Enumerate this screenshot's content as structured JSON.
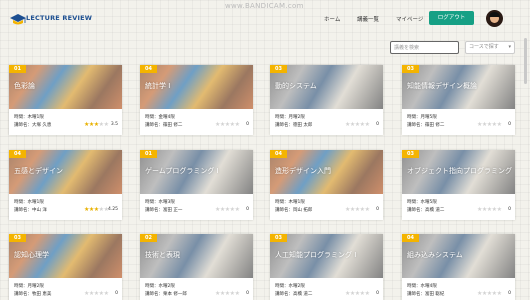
{
  "watermark": "www.BANDICAM.com",
  "logo": {
    "text": "LECTURE REVIEW"
  },
  "nav": {
    "home": "ホーム",
    "lectures": "講義一覧",
    "mypage": "マイページ",
    "logout": "ログアウト"
  },
  "search": {
    "placeholder": "講義を検索"
  },
  "filter": {
    "label": "コースで探す"
  },
  "labels": {
    "time": "時間：",
    "teacher": "講師名："
  },
  "colors": {
    "accent": "#16a085",
    "code_badge": "#f4b400",
    "star": "#e8b100"
  },
  "courses": [
    {
      "code": "01",
      "title": "色彩論",
      "time": "木曜1限",
      "teacher": "大塚 久恵",
      "stars": 3,
      "rating": "3.5",
      "image": "art"
    },
    {
      "code": "04",
      "title": "統計学 I",
      "time": "金曜4限",
      "teacher": "篠田 修二",
      "stars": 0,
      "rating": "0",
      "image": "art"
    },
    {
      "code": "03",
      "title": "動的システム",
      "time": "月曜2限",
      "teacher": "徳田 太郎",
      "stars": 0,
      "rating": "0",
      "image": "desk"
    },
    {
      "code": "03",
      "title": "知能情報デザイン概論",
      "time": "月曜5限",
      "teacher": "篠田 修二",
      "stars": 0,
      "rating": "0",
      "image": "desk"
    },
    {
      "code": "04",
      "title": "五感とデザイン",
      "time": "水曜1限",
      "teacher": "中山 洋",
      "stars": 3,
      "rating": "4.25",
      "image": "art"
    },
    {
      "code": "01",
      "title": "ゲームプログラミング I",
      "time": "水曜3限",
      "teacher": "富田 正一",
      "stars": 0,
      "rating": "0",
      "image": "desk"
    },
    {
      "code": "04",
      "title": "造形デザイン入門",
      "time": "木曜1限",
      "teacher": "岡山 拓郎",
      "stars": 0,
      "rating": "0",
      "image": "art"
    },
    {
      "code": "03",
      "title": "オブジェクト指向プログラミング",
      "time": "水曜5限",
      "teacher": "高橋 道二",
      "stars": 0,
      "rating": "0",
      "image": "desk"
    },
    {
      "code": "03",
      "title": "認知心理学",
      "time": "月曜2限",
      "teacher": "牧田 恵美",
      "stars": 0,
      "rating": "0",
      "image": "art"
    },
    {
      "code": "02",
      "title": "技術と表現",
      "time": "水曜2限",
      "teacher": "栗本 修一郎",
      "stars": 0,
      "rating": "0",
      "image": "desk"
    },
    {
      "code": "03",
      "title": "人工知能プログラミング I",
      "time": "水曜2限",
      "teacher": "高橋 道二",
      "stars": 0,
      "rating": "0",
      "image": "desk"
    },
    {
      "code": "04",
      "title": "組み込みシステム",
      "time": "水曜4限",
      "teacher": "富田 聡紀",
      "stars": 0,
      "rating": "0",
      "image": "desk"
    }
  ]
}
